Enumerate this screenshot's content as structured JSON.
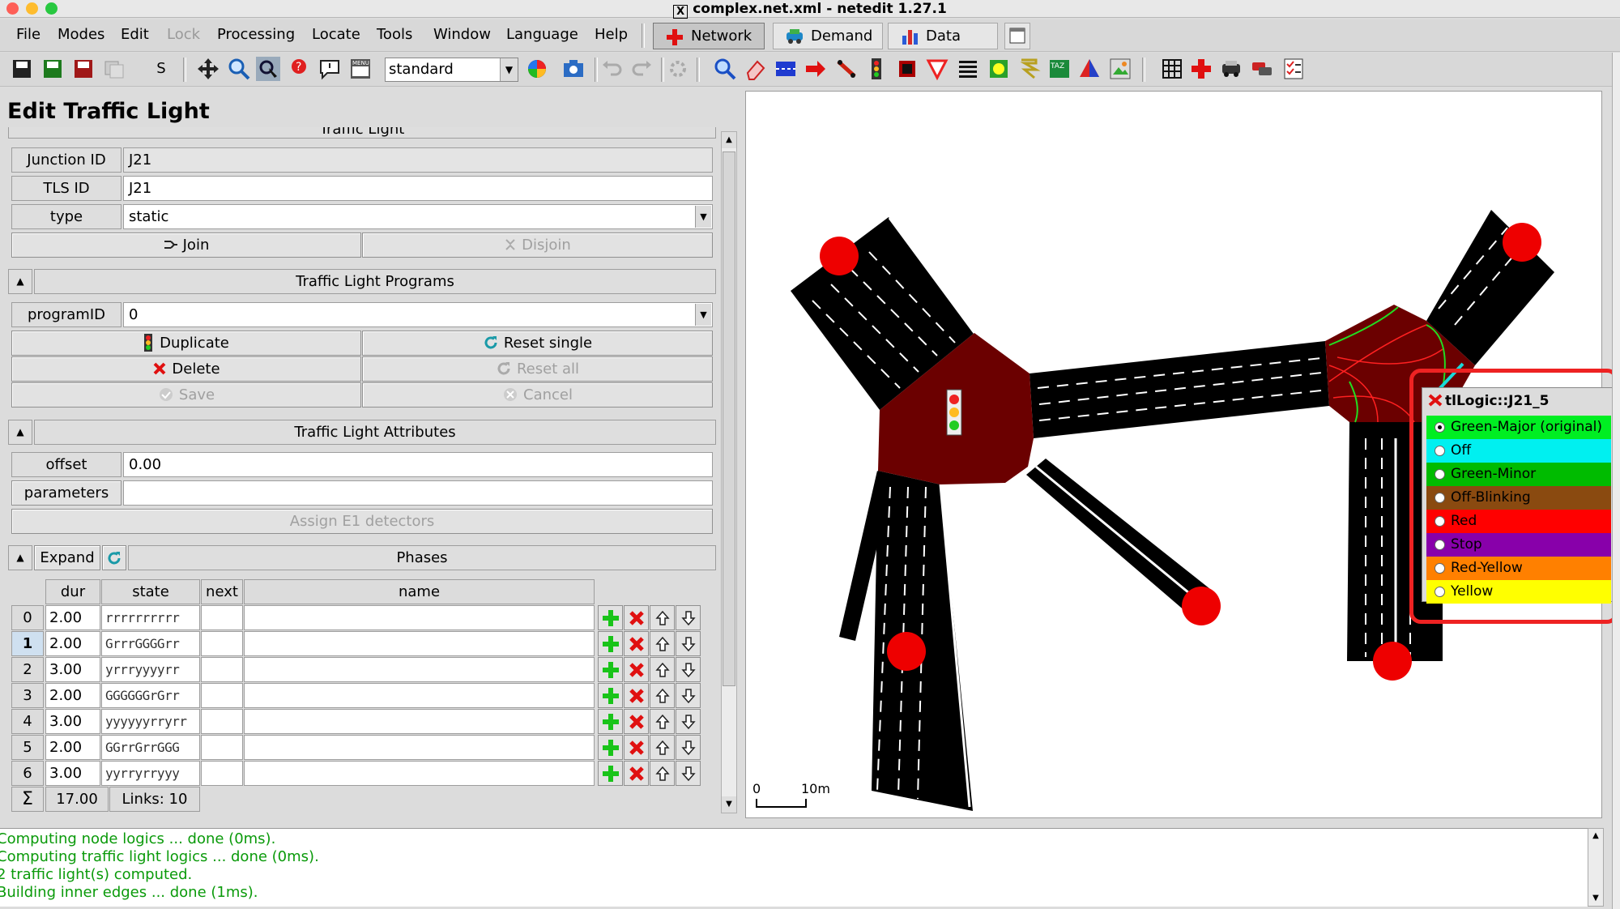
{
  "window": {
    "title": "complex.net.xml - netedit 1.27.1",
    "title_icon": "X"
  },
  "colors": {
    "junction_fill": "#6b0000",
    "road": "#000000",
    "lane_marking": "#ffffff",
    "tls_red_dot": "#ee0000",
    "log_text": "#0a9a0a",
    "highlight": "#ee2222"
  },
  "menubar": {
    "items": [
      {
        "label": "File",
        "accel": "F"
      },
      {
        "label": "Modes",
        "accel": "M"
      },
      {
        "label": "Edit",
        "accel": "E"
      },
      {
        "label": "Lock",
        "accel": "",
        "disabled": true
      },
      {
        "label": "Processing",
        "accel": "P"
      },
      {
        "label": "Locate",
        "accel": "L"
      },
      {
        "label": "Tools",
        "accel": "T"
      },
      {
        "label": "Window",
        "accel": "W"
      },
      {
        "label": "Language",
        "accel": "a"
      },
      {
        "label": "Help",
        "accel": "H"
      }
    ],
    "supermodes": {
      "network": "Network",
      "demand": "Demand",
      "data": "Data"
    }
  },
  "toolbar": {
    "s_label": "S",
    "viewport_scheme": "standard"
  },
  "panel": {
    "title": "Edit Traffic Light",
    "traffic_light_frame": "Traffic Light",
    "junction_id_label": "Junction ID",
    "junction_id_value": "J21",
    "tls_id_label": "TLS ID",
    "tls_id_value": "J21",
    "type_label": "type",
    "type_value": "static",
    "join_label": "Join",
    "disjoin_label": "Disjoin",
    "programs_header": "Traffic Light Programs",
    "program_id_label": "programID",
    "program_id_value": "0",
    "duplicate_label": "Duplicate",
    "reset_single_label": "Reset single",
    "delete_label": "Delete",
    "reset_all_label": "Reset all",
    "save_label": "Save",
    "cancel_label": "Cancel",
    "attributes_header": "Traffic Light Attributes",
    "offset_label": "offset",
    "offset_value": "0.00",
    "parameters_label": "parameters",
    "parameters_value": "",
    "assign_e1_label": "Assign E1 detectors",
    "expand_label": "Expand",
    "phases_header": "Phases"
  },
  "phases": {
    "columns": [
      "dur",
      "state",
      "next",
      "name"
    ],
    "rows": [
      {
        "index": "0",
        "dur": "2.00",
        "state": "rrrrrrrrrr",
        "next": "",
        "name": ""
      },
      {
        "index": "1",
        "dur": "2.00",
        "state": "GrrrGGGGrr",
        "next": "",
        "name": ""
      },
      {
        "index": "2",
        "dur": "3.00",
        "state": "yrrryyyyrr",
        "next": "",
        "name": ""
      },
      {
        "index": "3",
        "dur": "2.00",
        "state": "GGGGGGrGrr",
        "next": "",
        "name": ""
      },
      {
        "index": "4",
        "dur": "3.00",
        "state": "yyyyyyrryrr",
        "next": "",
        "name": ""
      },
      {
        "index": "5",
        "dur": "2.00",
        "state": "GGrrGrrGGG",
        "next": "",
        "name": ""
      },
      {
        "index": "6",
        "dur": "3.00",
        "state": "yyrryrryyy",
        "next": "",
        "name": ""
      }
    ],
    "selected_index": "1",
    "sum_symbol": "Σ",
    "total_dur": "17.00",
    "links": "Links: 10"
  },
  "canvas": {
    "scale_zero": "0",
    "scale_label": "10m"
  },
  "popup": {
    "title": "tlLogic::J21_5",
    "options": [
      {
        "label": "Green-Major (original)",
        "color": "#00ee22",
        "checked": true
      },
      {
        "label": "Off",
        "color": "#00f0f0",
        "checked": false
      },
      {
        "label": "Green-Minor",
        "color": "#00bb00",
        "checked": false
      },
      {
        "label": "Off-Blinking",
        "color": "#8a4a10",
        "checked": false
      },
      {
        "label": "Red",
        "color": "#ff0000",
        "checked": false
      },
      {
        "label": "Stop",
        "color": "#8800aa",
        "checked": false
      },
      {
        "label": "Red-Yellow",
        "color": "#ff8000",
        "checked": false
      },
      {
        "label": "Yellow",
        "color": "#ffff00",
        "checked": false
      }
    ]
  },
  "log": {
    "lines": [
      "Computing node logics ... done (0ms).",
      "Computing traffic light logics ... done (0ms).",
      " 2 traffic light(s) computed.",
      "Building inner edges ... done (1ms)."
    ]
  }
}
